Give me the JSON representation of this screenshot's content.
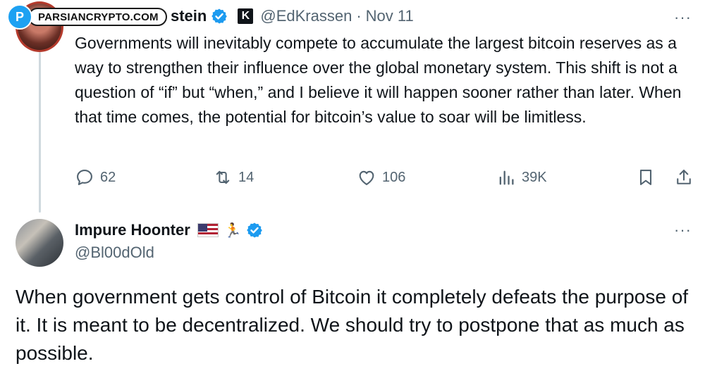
{
  "watermark": {
    "logo_letter": "P",
    "text": "PARSIANCRYPTO.COM"
  },
  "tweet1": {
    "name_visible": "stein",
    "handle": "@EdKrassen",
    "separator": "·",
    "date": "Nov 11",
    "more": "···",
    "text": "Governments will inevitably compete to accumulate the largest bitcoin reserves as a way to strengthen their influence over the global monetary system. This shift is not a question of “if” but “when,” and I believe it will happen sooner rather than later. When that time comes, the potential for bitcoin’s value to soar will be limitless.",
    "badge_letter": "K",
    "actions": {
      "replies": "62",
      "reposts": "14",
      "likes": "106",
      "views": "39K"
    }
  },
  "tweet2": {
    "name": "Impure Hoonter",
    "runner_glyph": "🏃",
    "handle": "@Bl00dOld",
    "more": "···",
    "text": "When government gets control of Bitcoin it completely defeats the purpose of it. It is meant to be decentralized. We should try to postpone that as much as possible."
  },
  "colors": {
    "text": "#0f1419",
    "secondary": "#536471",
    "verified_blue": "#1d9bf0",
    "thread_line": "#cfd9de"
  },
  "icons": [
    "reply-icon",
    "repost-icon",
    "like-icon",
    "views-icon",
    "bookmark-icon",
    "share-icon",
    "verified-icon",
    "more-icon"
  ]
}
